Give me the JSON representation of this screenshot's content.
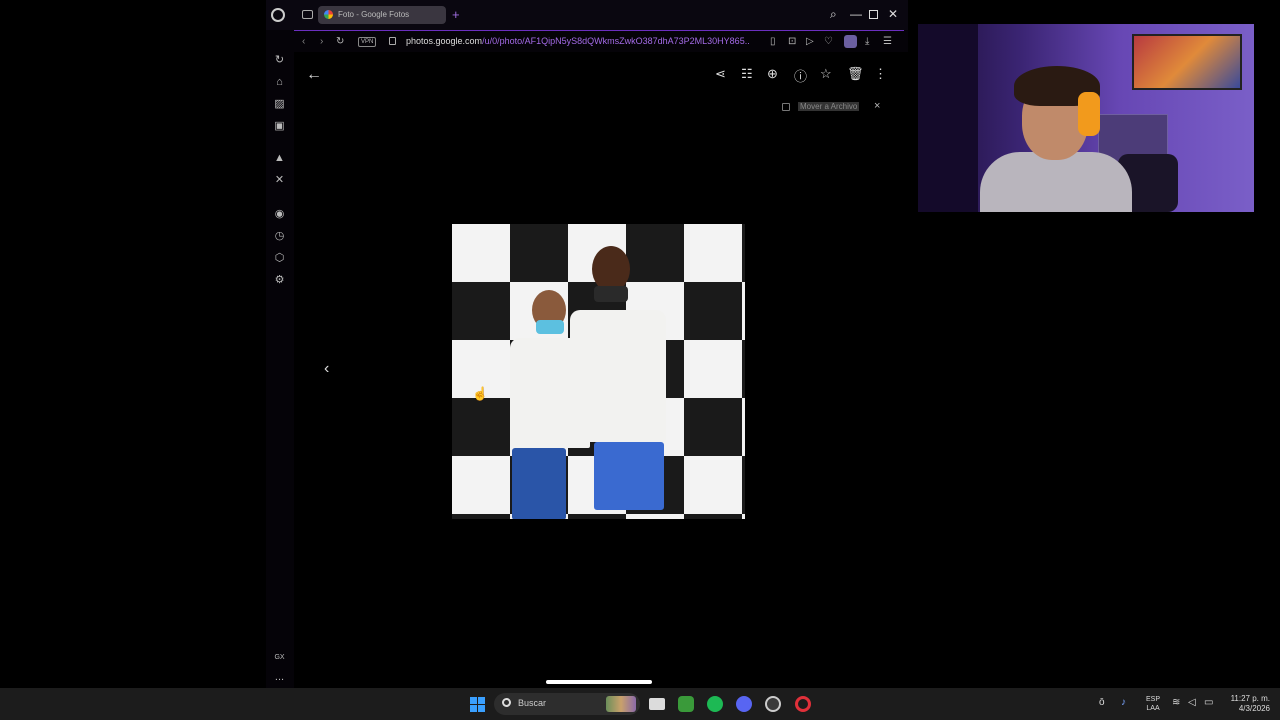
{
  "browser": {
    "tab_title": "Foto - Google Fotos",
    "new_tab": "+",
    "url_domain": "photos.google.com",
    "url_path": "/u/0/photo/AF1QipN5yS8dQWkmsZwkO387dhA73P2ML30HY865..",
    "vpn_label": "VPN",
    "accent_color": "#a46be8"
  },
  "viewer": {
    "toast_text": "Mover a Archivo",
    "toast_close": "×",
    "back_icon": "arrow-left-icon",
    "prev_icon": "chevron-left-icon",
    "tools": [
      "share-icon",
      "edit-icon",
      "zoom-icon",
      "info-icon",
      "star-icon",
      "trash-icon",
      "more-icon"
    ]
  },
  "sidebar": {
    "gx_label": "GX",
    "more_label": "...",
    "icons": [
      "refresh-icon",
      "bag-icon",
      "news-icon",
      "messenger-icon",
      "aria-icon",
      "x-icon",
      "player-icon",
      "history-icon",
      "extensions-icon",
      "settings-icon"
    ]
  },
  "taskbar": {
    "search_label": "Buscar",
    "lang_line1": "ESP",
    "lang_line2": "LAA",
    "time": "11:27 p. m.",
    "date": "4/3/2026"
  }
}
